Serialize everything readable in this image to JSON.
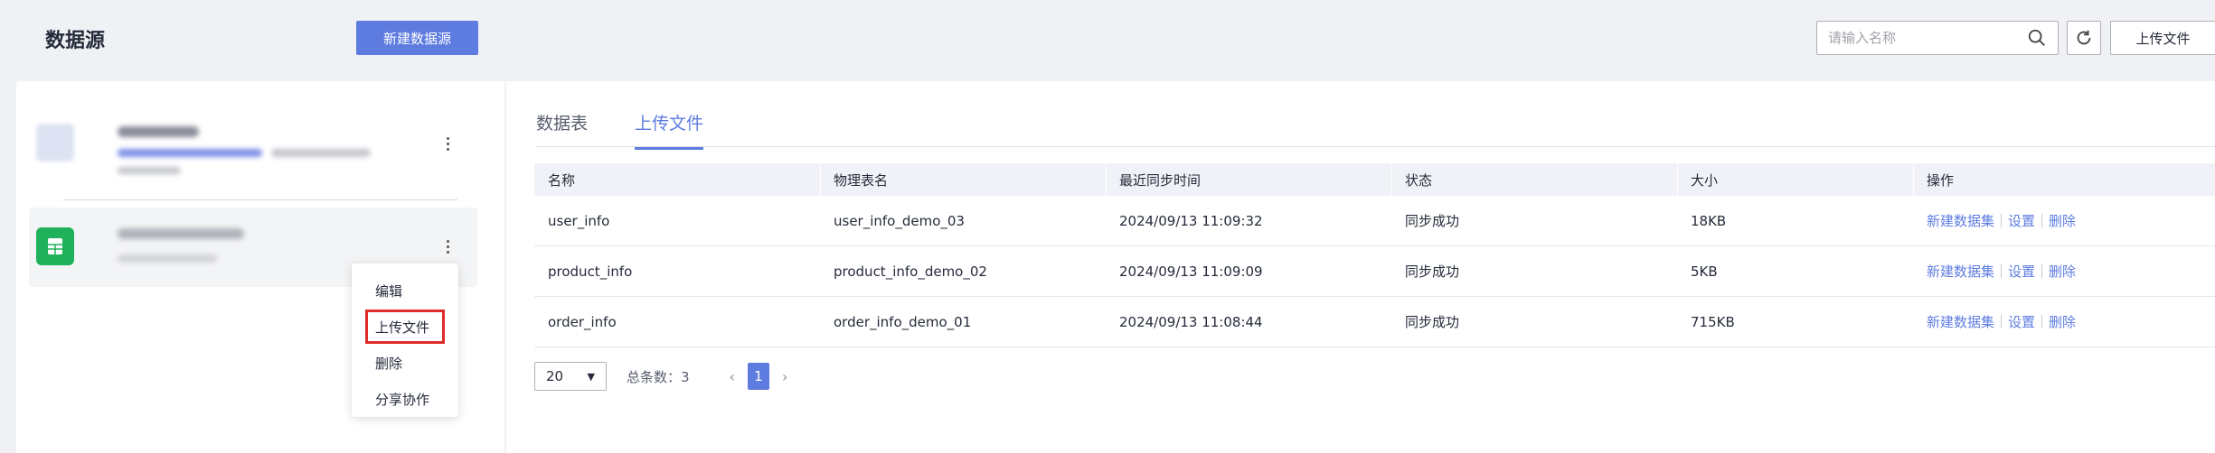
{
  "header": {
    "title": "数据源",
    "new_button": "新建数据源",
    "search_placeholder": "请输入名称",
    "upload_button": "上传文件"
  },
  "context_menu": {
    "items": [
      "编辑",
      "上传文件",
      "删除",
      "分享协作"
    ]
  },
  "tabs": [
    "数据表",
    "上传文件"
  ],
  "active_tab": "上传文件",
  "table": {
    "columns": [
      "名称",
      "物理表名",
      "最近同步时间",
      "状态",
      "大小",
      "操作"
    ],
    "rows": [
      {
        "name": "user_info",
        "physical": "user_info_demo_03",
        "time": "2024/09/13 11:09:32",
        "status": "同步成功",
        "size": "18KB"
      },
      {
        "name": "product_info",
        "physical": "product_info_demo_02",
        "time": "2024/09/13 11:09:09",
        "status": "同步成功",
        "size": "5KB"
      },
      {
        "name": "order_info",
        "physical": "order_info_demo_01",
        "time": "2024/09/13 11:08:44",
        "status": "同步成功",
        "size": "715KB"
      }
    ],
    "actions": [
      "新建数据集",
      "设置",
      "删除"
    ]
  },
  "pagination": {
    "page_size": "20",
    "total_label": "总条数：3",
    "current_page": "1"
  },
  "colors": {
    "accent": "#5e7ce0",
    "highlight": "#e02b2b",
    "excel_green": "#1fb25a"
  }
}
